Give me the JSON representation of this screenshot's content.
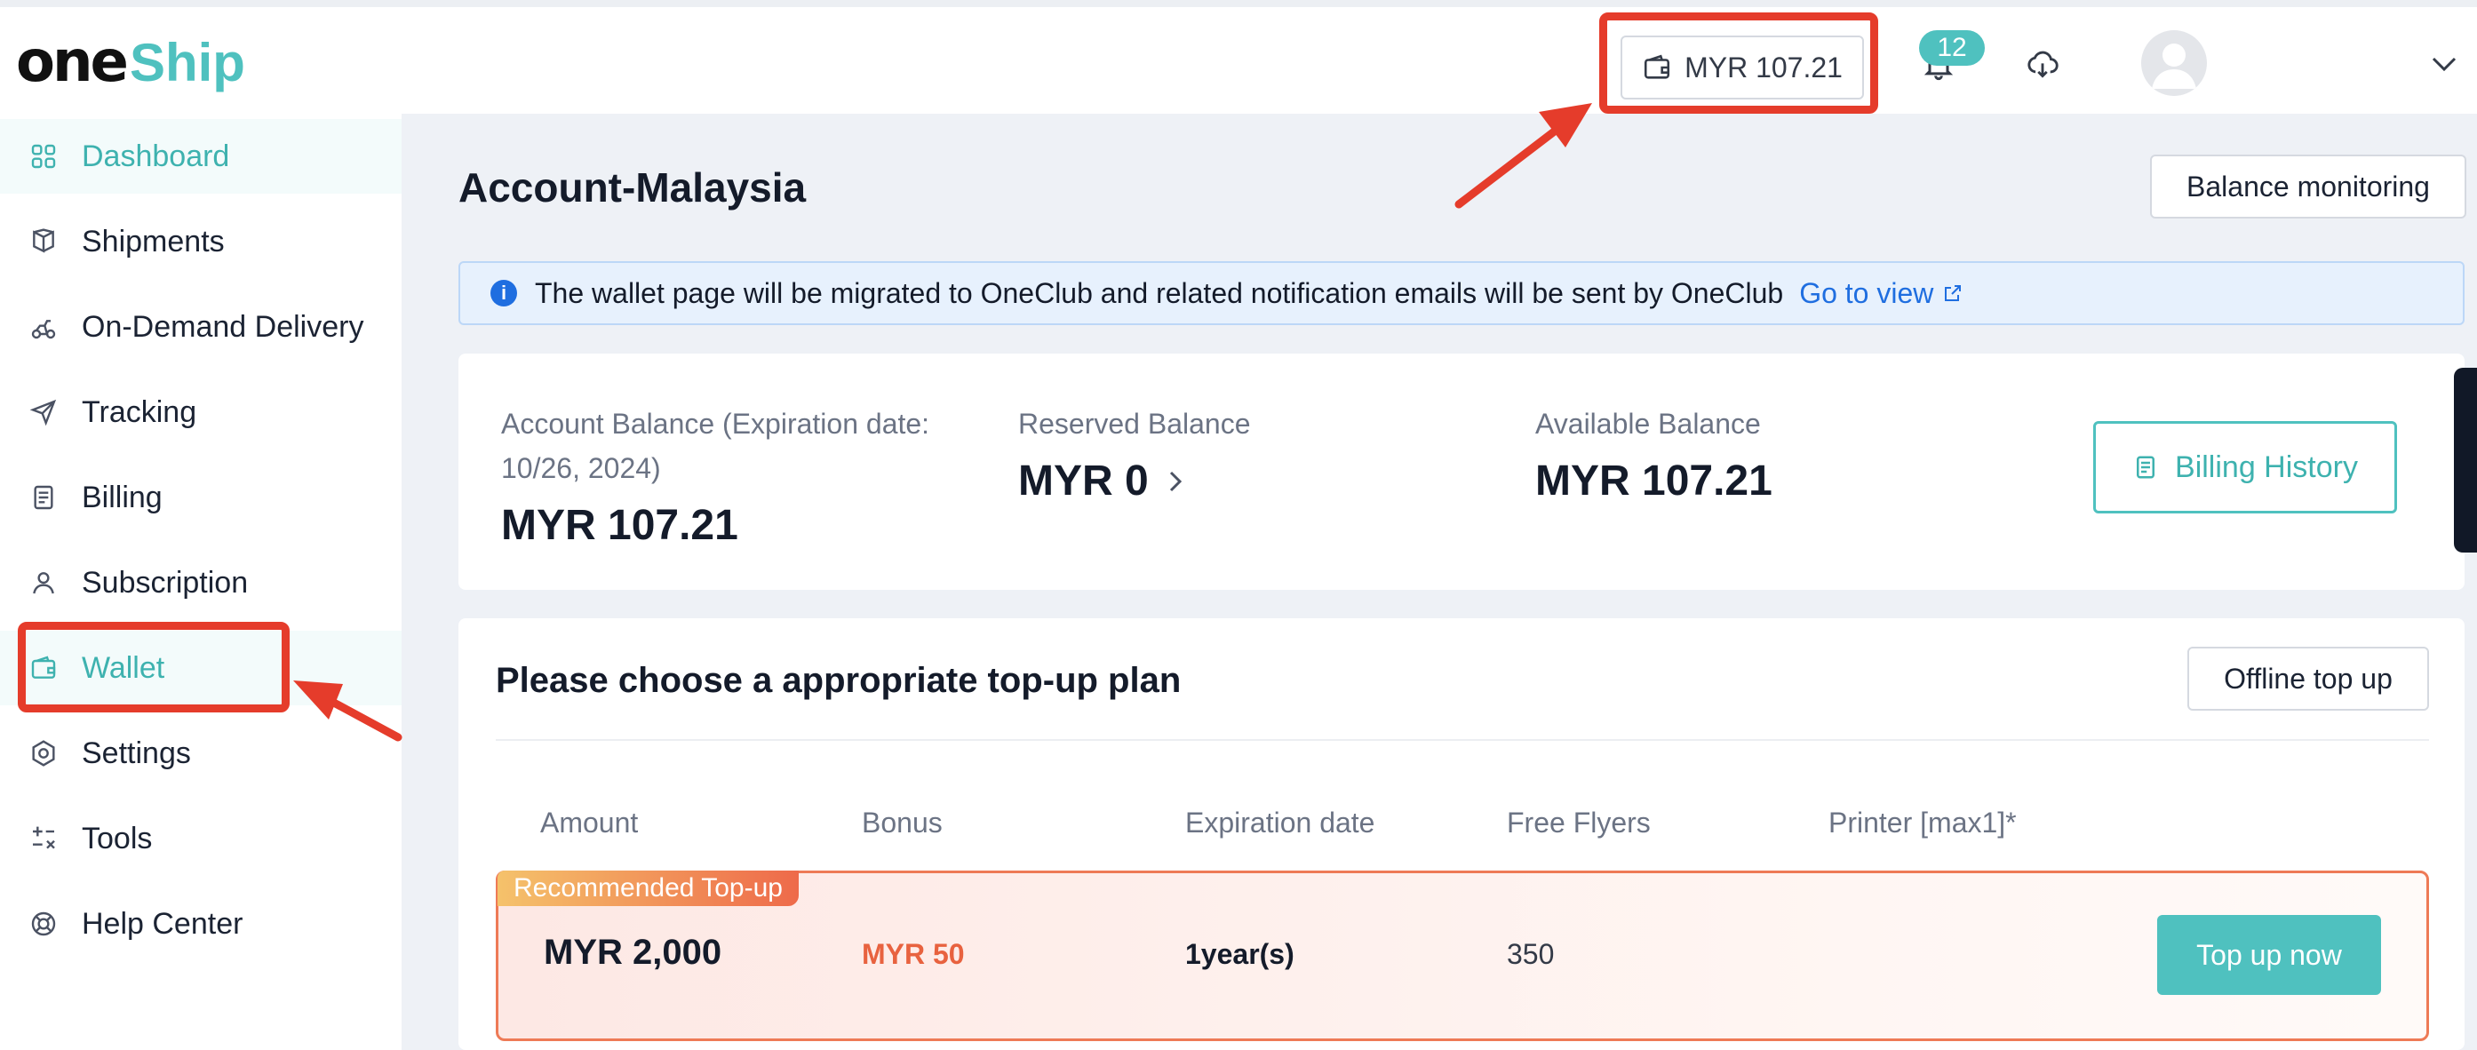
{
  "header": {
    "logo_one": "one",
    "logo_ship": "Ship",
    "balance_chip": "MYR 107.21",
    "notifications_count": "12"
  },
  "sidebar": {
    "items": [
      {
        "label": "Dashboard",
        "icon": "dashboard-icon"
      },
      {
        "label": "Shipments",
        "icon": "shipments-icon"
      },
      {
        "label": "On-Demand Delivery",
        "icon": "delivery-icon"
      },
      {
        "label": "Tracking",
        "icon": "send-icon"
      },
      {
        "label": "Billing",
        "icon": "billing-icon"
      },
      {
        "label": "Subscription",
        "icon": "user-icon"
      },
      {
        "label": "Wallet",
        "icon": "wallet-icon"
      },
      {
        "label": "Settings",
        "icon": "settings-icon"
      },
      {
        "label": "Tools",
        "icon": "tools-icon"
      },
      {
        "label": "Help Center",
        "icon": "help-icon"
      }
    ]
  },
  "main": {
    "title": "Account-Malaysia",
    "balance_monitoring_label": "Balance monitoring",
    "notice_text": "The wallet page will be migrated to OneClub and related notification emails will be sent by OneClub",
    "notice_link": "Go to view",
    "account_balance_label_1": "Account Balance (Expiration date:",
    "account_balance_label_2": "10/26, 2024)",
    "account_balance_value": "MYR 107.21",
    "reserved_label": "Reserved Balance",
    "reserved_value": "MYR 0",
    "available_label": "Available Balance",
    "available_value": "MYR 107.21",
    "billing_history_label": "Billing History",
    "plan_title": "Please choose a appropriate top-up plan",
    "offline_topup_label": "Offline top up",
    "table_headers": [
      "Amount",
      "Bonus",
      "Expiration date",
      "Free Flyers",
      "Printer [max1]*"
    ],
    "recommended_tag": "Recommended Top-up",
    "recommended_row": {
      "amount": "MYR 2,000",
      "bonus": "MYR 50",
      "expiration": "1year(s)",
      "free_flyers": "350",
      "printer": ""
    },
    "topup_button": "Top up now"
  },
  "colors": {
    "accent": "#4fc1bf",
    "highlight_red": "#e53c2b",
    "bonus_orange": "#e8623f",
    "link_blue": "#1f6ee0"
  }
}
